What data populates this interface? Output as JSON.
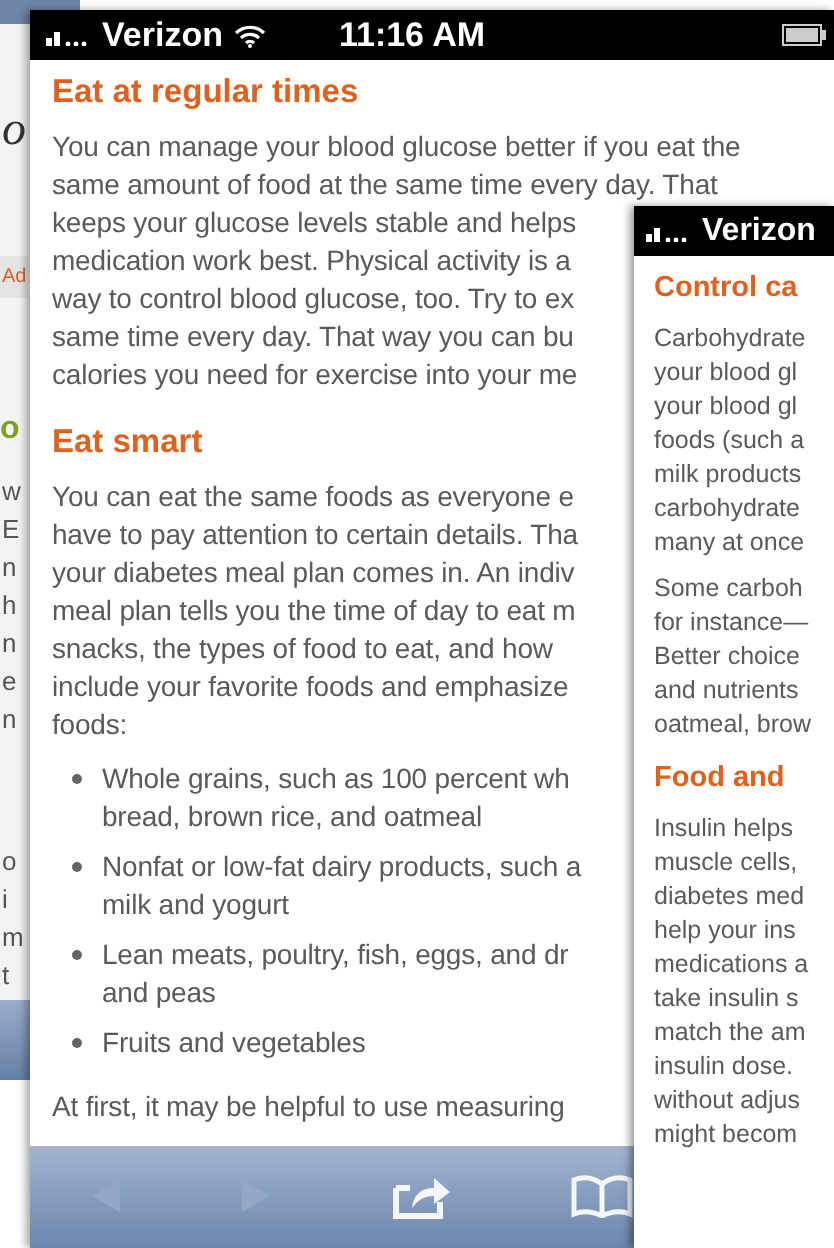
{
  "left_phone": {
    "logo_fragment": "o",
    "button_fragment": "Ad",
    "heading_fragment": "o",
    "text_fragments": [
      "w",
      "E",
      "n",
      "h",
      "n",
      "e",
      "n"
    ],
    "lower_fragments": [
      "o",
      "i",
      "m",
      "t"
    ]
  },
  "middle_phone": {
    "status_bar": {
      "carrier": "Verizon",
      "time": "11:16 AM"
    },
    "sections": [
      {
        "heading": "Eat at regular times",
        "paragraph_lines": [
          "You can manage your blood glucose better if you eat the",
          "same amount of food at the same time every day. That",
          "keeps your glucose levels stable and helps",
          "medication work best. Physical activity is a",
          "way to control blood glucose, too. Try to ex",
          "same time every day. That way you can bu",
          "calories you need for exercise into your me"
        ]
      },
      {
        "heading": "Eat smart",
        "paragraph_lines": [
          "You can eat the same foods as everyone e",
          "have to pay attention to certain details. Tha",
          "your diabetes meal plan comes in. An indiv",
          "meal plan tells you the time of day to eat m",
          "snacks, the types of food to eat, and how",
          "include your favorite foods and emphasize",
          "foods:"
        ],
        "bullets": [
          [
            "Whole grains, such as 100 percent wh",
            "bread, brown rice, and oatmeal"
          ],
          [
            "Nonfat or low-fat dairy products, such a",
            "milk and yogurt"
          ],
          [
            "Lean meats, poultry, fish, eggs, and dr",
            "and peas"
          ],
          [
            "Fruits and vegetables"
          ]
        ],
        "closing_line": "At first, it may be helpful to use measuring"
      }
    ],
    "toolbar": [
      {
        "kind": "back",
        "disabled": true
      },
      {
        "kind": "forward",
        "disabled": true
      },
      {
        "kind": "share",
        "disabled": false
      },
      {
        "kind": "bookmarks",
        "disabled": false
      }
    ]
  },
  "right_phone": {
    "status_bar": {
      "carrier": "Verizon"
    },
    "sections": [
      {
        "heading": "Control ca",
        "paragraphs": [
          [
            "Carbohydrate",
            "your blood gl",
            "your blood gl",
            "foods (such a",
            "milk products",
            "carbohydrate",
            "many at once"
          ],
          [
            "Some carboh",
            "for instance—",
            "Better choice",
            "and nutrients",
            "oatmeal, brow"
          ]
        ]
      },
      {
        "heading": "Food and",
        "paragraphs": [
          [
            "Insulin helps",
            "muscle cells,",
            "diabetes med",
            "help your ins",
            "medications a",
            "take insulin s",
            "match the am",
            "insulin dose.",
            "without adjus",
            "might becom"
          ]
        ]
      }
    ]
  }
}
